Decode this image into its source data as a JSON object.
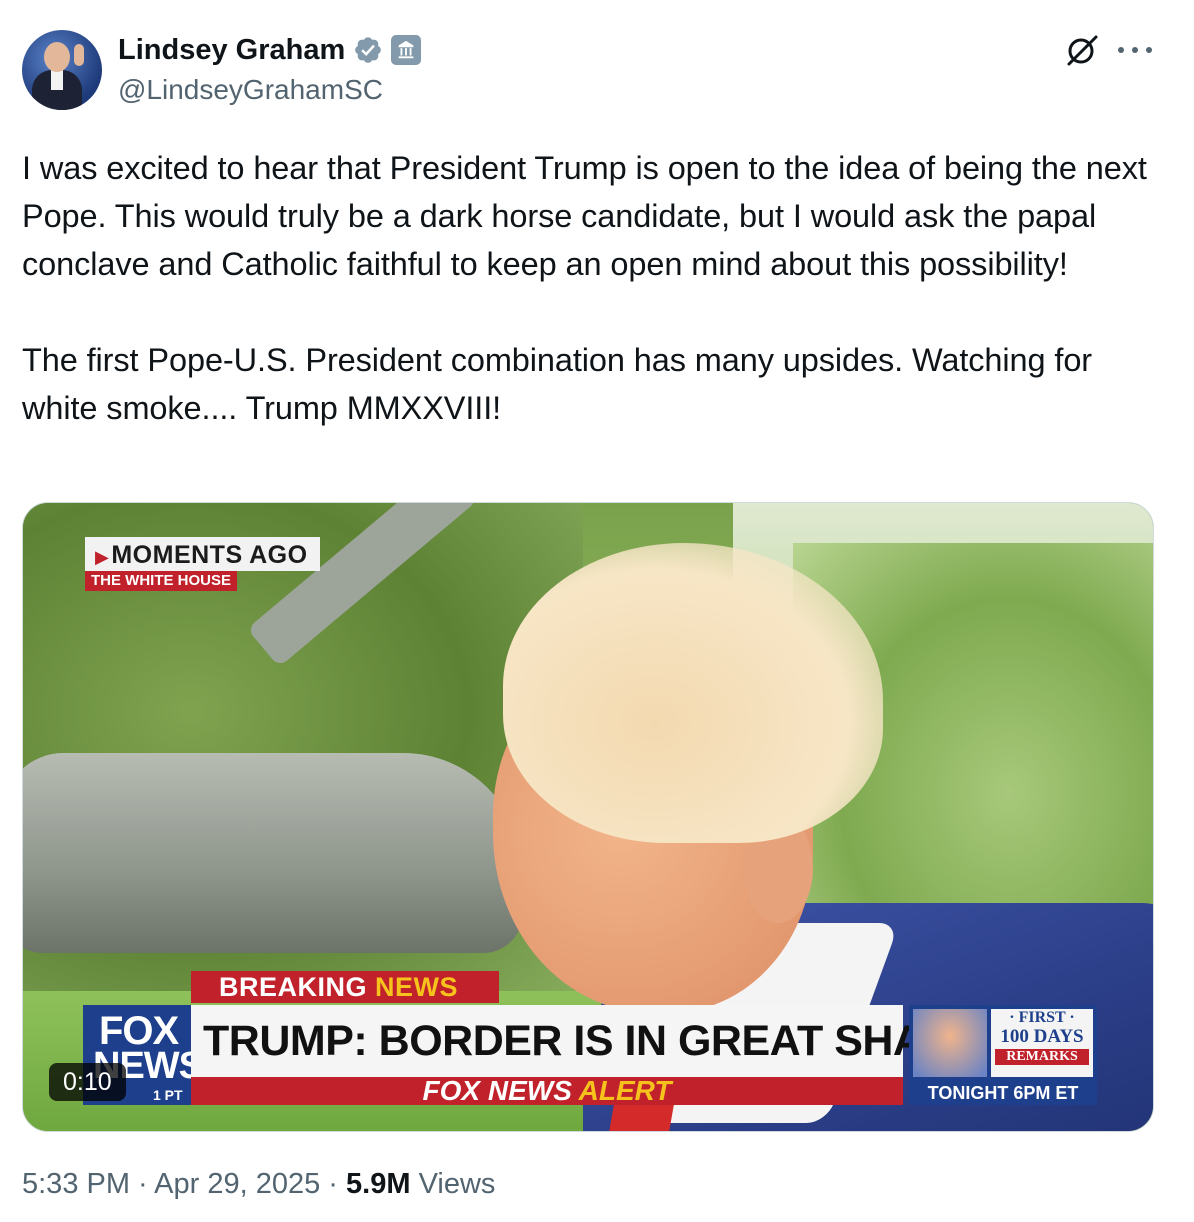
{
  "author": {
    "name": "Lindsey Graham",
    "handle": "@LindseyGrahamSC",
    "verified_badge_color": "#829aab",
    "affiliation_icon": "government-building-icon"
  },
  "tweet": {
    "paragraphs": [
      "I was excited to hear that President Trump is open to the idea of being the next Pope. This would truly be a dark horse candidate, but I would ask the papal conclave and Catholic faithful to keep an open mind about this possibility!",
      "The first Pope-U.S. President combination has many upsides. Watching for white smoke.... Trump MMXXVIII!"
    ]
  },
  "media": {
    "duration": "0:10",
    "overlay": {
      "moments_label": "MOMENTS AGO",
      "location_label": "THE WHITE HOUSE",
      "breaking_label": "BREAKING",
      "breaking_news_label": "NEWS",
      "headline": "TRUMP: BORDER IS IN GREAT SHAPE",
      "alert_part1": "FOX NEWS",
      "alert_part2": "ALERT",
      "logo_line1": "FOX",
      "logo_line2": "NEWS",
      "logo_line3": "1 PT",
      "remarks_line1": "· FIRST ·",
      "remarks_line2": "100 DAYS",
      "remarks_line3": "REMARKS",
      "remarks_tonight": "TONIGHT 6PM ET"
    }
  },
  "meta": {
    "time": "5:33 PM",
    "separator": " · ",
    "date": "Apr 29, 2025",
    "views_count": "5.9M",
    "views_label": "Views"
  },
  "colors": {
    "text_primary": "#0f1419",
    "text_secondary": "#536471",
    "fox_red": "#c0212a",
    "fox_blue": "#1d3f8c",
    "fox_yellow": "#f6c21c"
  }
}
